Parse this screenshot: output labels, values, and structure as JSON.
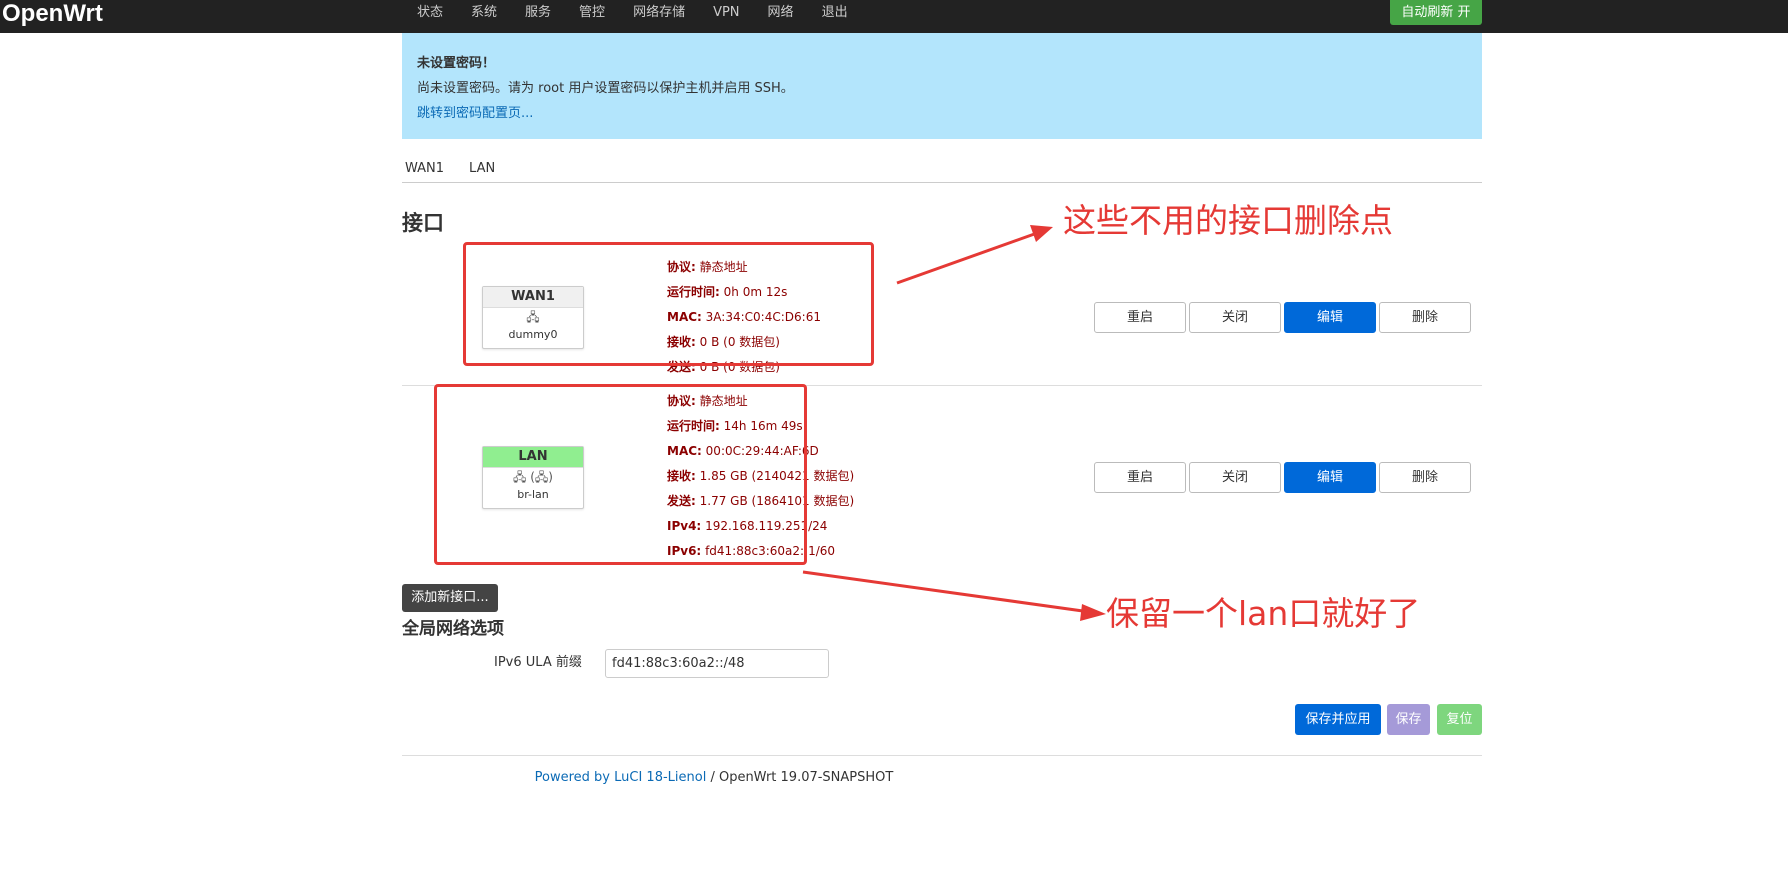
{
  "brand": "OpenWrt",
  "nav": [
    "状态",
    "系统",
    "服务",
    "管控",
    "网络存储",
    "VPN",
    "网络",
    "退出"
  ],
  "auto_refresh": "自动刷新 开",
  "alert": {
    "title": "未设置密码！",
    "desc": "尚未设置密码。请为 root 用户设置密码以保护主机并启用 SSH。",
    "link": "跳转到密码配置页..."
  },
  "tabs": [
    "WAN1",
    "LAN"
  ],
  "section_title": "接口",
  "interfaces": [
    {
      "name": "WAN1",
      "header_color": "#f0f0f0",
      "icon": "🖧",
      "device": "dummy0",
      "info": [
        {
          "label": "协议:",
          "value": "静态地址"
        },
        {
          "label": "运行时间:",
          "value": "0h 0m 12s"
        },
        {
          "label": "MAC:",
          "value": "3A:34:C0:4C:D6:61"
        },
        {
          "label": "接收:",
          "value": "0 B (0 数据包)"
        },
        {
          "label": "发送:",
          "value": "0 B (0 数据包)"
        }
      ]
    },
    {
      "name": "LAN",
      "header_color": "#90ee90",
      "icon": "🖧 (🖧)",
      "device": "br-lan",
      "info": [
        {
          "label": "协议:",
          "value": "静态地址"
        },
        {
          "label": "运行时间:",
          "value": "14h 16m 49s"
        },
        {
          "label": "MAC:",
          "value": "00:0C:29:44:AF:6D"
        },
        {
          "label": "接收:",
          "value": "1.85 GB (2140421 数据包)"
        },
        {
          "label": "发送:",
          "value": "1.77 GB (1864101 数据包)"
        },
        {
          "label": "IPv4:",
          "value": "192.168.119.251/24"
        },
        {
          "label": "IPv6:",
          "value": "fd41:88c3:60a2::1/60"
        }
      ]
    }
  ],
  "row_buttons": {
    "restart": "重启",
    "stop": "关闭",
    "edit": "编辑",
    "delete": "删除"
  },
  "add_interface": "添加新接口...",
  "global_title": "全局网络选项",
  "ula_label": "IPv6 ULA 前缀",
  "ula_value": "fd41:88c3:60a2::/48",
  "actions": {
    "save_apply": "保存并应用",
    "save": "保存",
    "reset": "复位"
  },
  "footer": {
    "powered": "Powered by LuCI 18-Lienol",
    "version": " / OpenWrt 19.07-SNAPSHOT"
  },
  "annotations": {
    "top": "这些不用的接口删除点",
    "bottom": "保留一个lan口就好了",
    "color": "#e53935"
  }
}
